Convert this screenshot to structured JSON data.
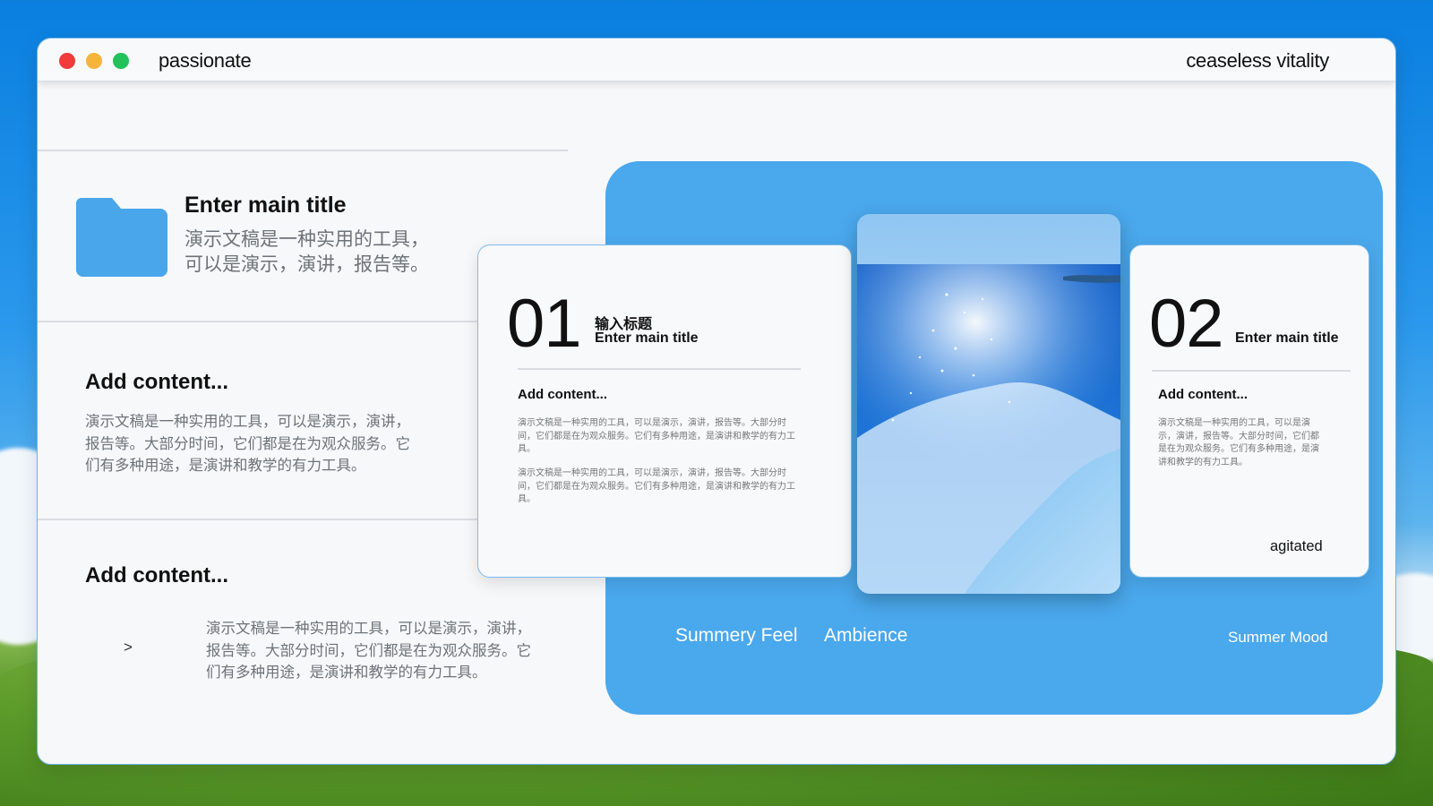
{
  "window": {
    "title": "passionate",
    "right_label": "ceaseless vitality"
  },
  "left": {
    "main": {
      "title": "Enter main title",
      "line1": "演示文稿是一种实用的工具，",
      "line2": "可以是演示，演讲，报告等。"
    },
    "block1": {
      "title": "Add content...",
      "line1": "演示文稿是一种实用的工具，可以是演示，演讲，",
      "line2": "报告等。大部分时间，它们都是在为观众服务。它",
      "line3": "们有多种用途，是演讲和教学的有力工具。"
    },
    "block2": {
      "title": "Add content...",
      "arrow": ">",
      "line1": "演示文稿是一种实用的工具，可以是演示，演讲，",
      "line2": "报告等。大部分时间，它们都是在为观众服务。它",
      "line3": "们有多种用途，是演讲和教学的有力工具。"
    }
  },
  "card1": {
    "number": "01",
    "title_cn": "输入标题",
    "title_en": "Enter main title",
    "subtitle": "Add content...",
    "para1": [
      "演示文稿是一种实用的工具，可以是演示，演讲，报告等。大部分时",
      "间，它们都是在为观众服务。它们有多种用途，是演讲和教学的有力工",
      "具。"
    ],
    "para2": [
      "演示文稿是一种实用的工具，可以是演示，演讲，报告等。大部分时",
      "间，它们都是在为观众服务。它们有多种用途，是演讲和教学的有力工",
      "具。"
    ]
  },
  "card2": {
    "number": "02",
    "title_en": "Enter main title",
    "subtitle": "Add content...",
    "para": [
      "演示文稿是一种实用的工具，可以是演",
      "示，演讲，报告等。大部分时间，它们都",
      "是在为观众服务。它们有多种用途，是演",
      "讲和教学的有力工具。"
    ],
    "footer": "agitated"
  },
  "panel": {
    "label1": "Summery Feel",
    "label2": "Ambience",
    "label3": "Summer Mood"
  },
  "colors": {
    "accent": "#4aa8ec",
    "folder": "#4aa6ea"
  }
}
